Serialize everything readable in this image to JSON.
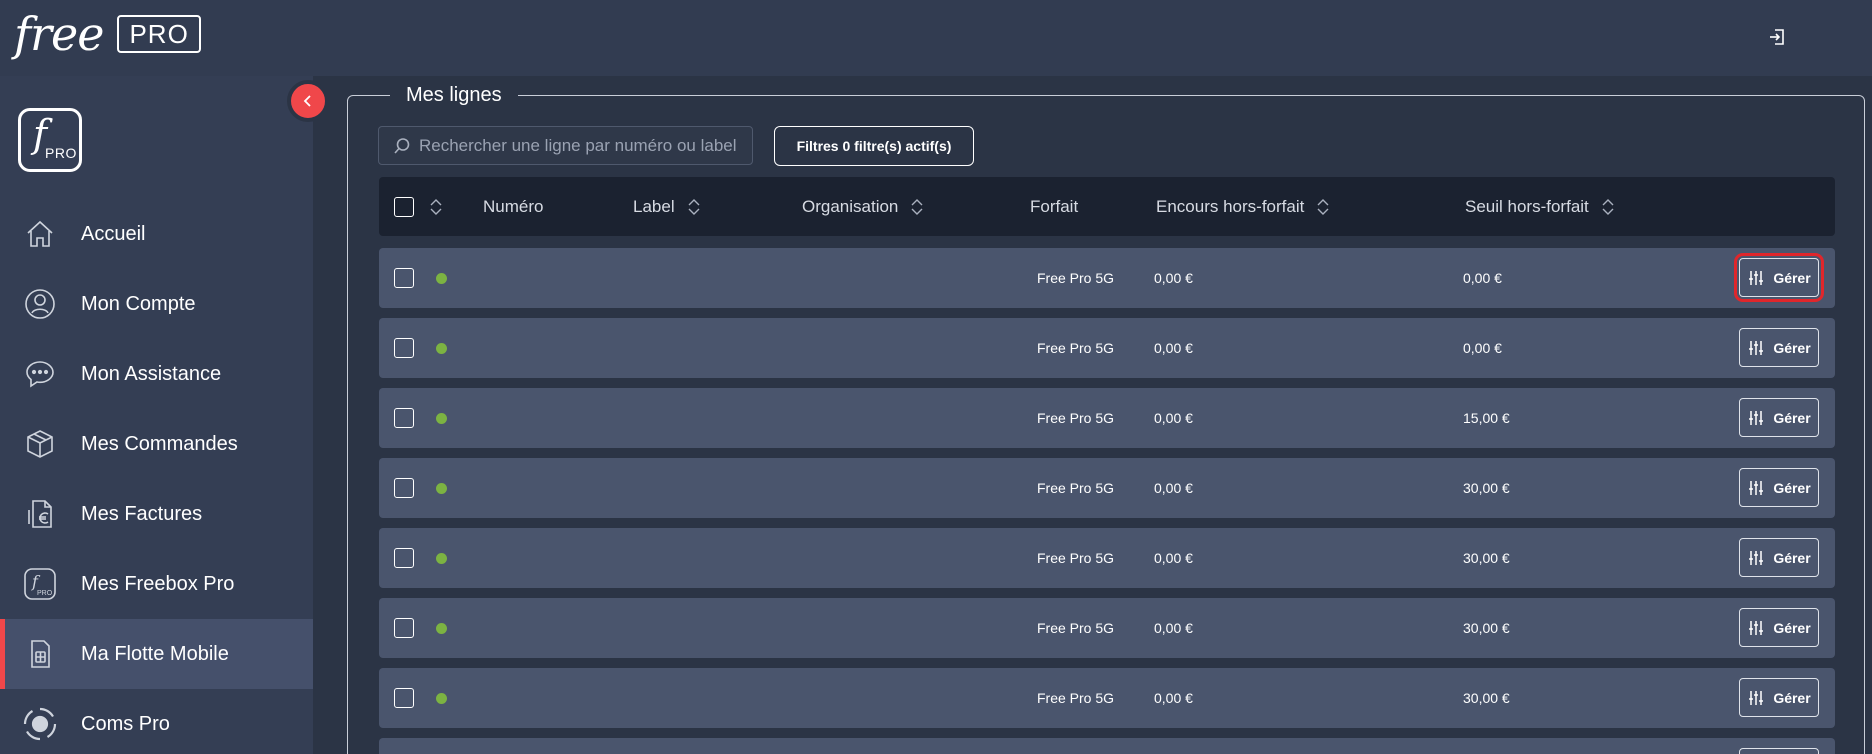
{
  "header": {
    "brand_free": "free",
    "brand_pro": "PRO",
    "logout_icon": "logout-icon"
  },
  "sidebar": {
    "logo_f": "f",
    "logo_pro": "PRO",
    "items": [
      {
        "label": "Accueil",
        "icon": "home-icon",
        "active": false
      },
      {
        "label": "Mon Compte",
        "icon": "user-icon",
        "active": false
      },
      {
        "label": "Mon Assistance",
        "icon": "chat-icon",
        "active": false
      },
      {
        "label": "Mes Commandes",
        "icon": "box-icon",
        "active": false
      },
      {
        "label": "Mes Factures",
        "icon": "invoice-euro-icon",
        "active": false
      },
      {
        "label": "Mes Freebox Pro",
        "icon": "freebox-pro-icon",
        "active": false
      },
      {
        "label": "Ma Flotte Mobile",
        "icon": "sim-card-icon",
        "active": true
      },
      {
        "label": "Coms Pro",
        "icon": "coms-icon",
        "active": false
      }
    ]
  },
  "main": {
    "title": "Mes lignes",
    "search_placeholder": "Rechercher une ligne par numéro ou label",
    "filters_label": "Filtres 0 filtre(s) actif(s)",
    "columns": {
      "numero": "Numéro",
      "label": "Label",
      "organisation": "Organisation",
      "forfait": "Forfait",
      "encours": "Encours hors-forfait",
      "seuil": "Seuil hors-forfait"
    },
    "rows": [
      {
        "forfait": "Free Pro 5G",
        "encours": "0,00 €",
        "seuil": "0,00 €",
        "action": "Gérer",
        "status": "active"
      },
      {
        "forfait": "Free Pro 5G",
        "encours": "0,00 €",
        "seuil": "0,00 €",
        "action": "Gérer",
        "status": "active"
      },
      {
        "forfait": "Free Pro 5G",
        "encours": "0,00 €",
        "seuil": "15,00 €",
        "action": "Gérer",
        "status": "active"
      },
      {
        "forfait": "Free Pro 5G",
        "encours": "0,00 €",
        "seuil": "30,00 €",
        "action": "Gérer",
        "status": "active"
      },
      {
        "forfait": "Free Pro 5G",
        "encours": "0,00 €",
        "seuil": "30,00 €",
        "action": "Gérer",
        "status": "active"
      },
      {
        "forfait": "Free Pro 5G",
        "encours": "0,00 €",
        "seuil": "30,00 €",
        "action": "Gérer",
        "status": "active"
      },
      {
        "forfait": "Free Pro 5G",
        "encours": "0,00 €",
        "seuil": "30,00 €",
        "action": "Gérer",
        "status": "active"
      }
    ]
  },
  "colors": {
    "accent": "#f0474a",
    "status_active": "#7cb342",
    "highlight": "#e0262b"
  }
}
